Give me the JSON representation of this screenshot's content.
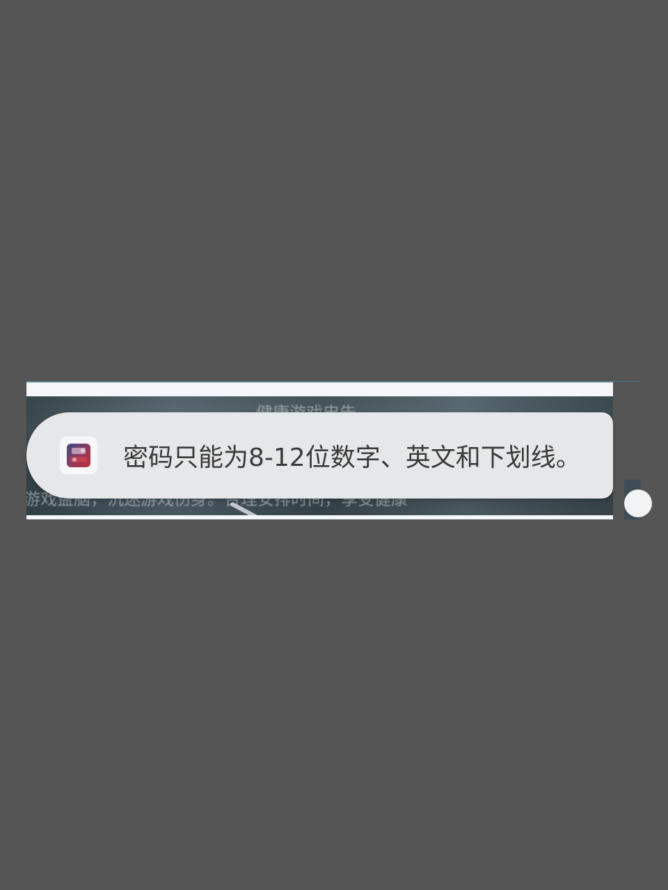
{
  "toast": {
    "app_icon": "game-app-icon",
    "message": "密码只能为8-12位数字、英文和下划线。"
  },
  "background": {
    "top_line": "健康游戏忠告",
    "bottom_line": "游戏益脑，沉迷游戏伤身。合理安排时间，享受健康"
  },
  "colors": {
    "page_background": "#555555",
    "toast_background": "#e6e7e8",
    "toast_text": "#3a3a3a"
  }
}
